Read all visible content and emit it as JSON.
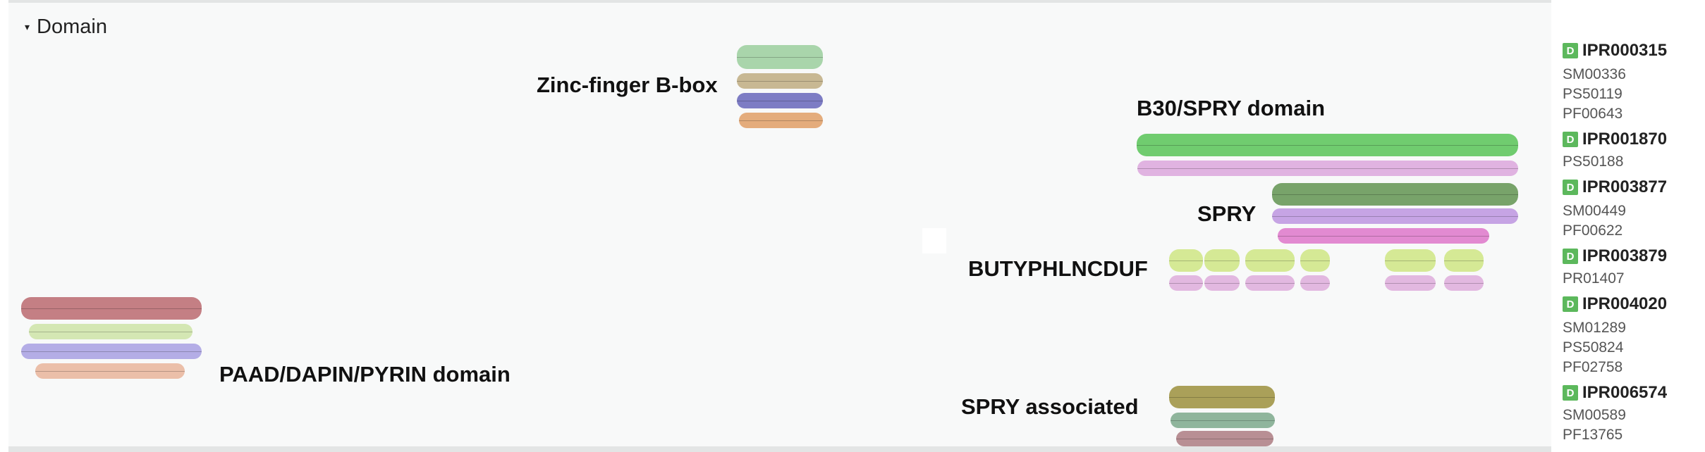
{
  "section": {
    "title": "Domain",
    "toggle_glyph": "▾"
  },
  "domains": [
    {
      "label": "Zinc-finger B-box",
      "track_colors": [
        "#a9d5ab",
        "#c8b893",
        "#7d7cc4",
        "#e4ac7c"
      ]
    },
    {
      "label": "B30/SPRY domain",
      "track_colors": [
        "#70cc6f",
        "#e0b3e1"
      ]
    },
    {
      "label": "SPRY",
      "track_colors": [
        "#78a36a",
        "#c6a4e4",
        "#e28ad1"
      ]
    },
    {
      "label": "BUTYPHLNCDUF",
      "track_colors": [
        "#d5e995",
        "#e2b8e0"
      ]
    },
    {
      "label": "PAAD/DAPIN/PYRIN domain",
      "track_colors": [
        "#c47f84",
        "#d4e7b3",
        "#b4ade6",
        "#ebbfa9"
      ]
    },
    {
      "label": "SPRY associated",
      "track_colors": [
        "#aaa059",
        "#8fb59c",
        "#b88f94"
      ]
    }
  ],
  "entries": [
    {
      "badge": "D",
      "id": "IPR000315",
      "members": [
        "SM00336",
        "PS50119",
        "PF00643"
      ]
    },
    {
      "badge": "D",
      "id": "IPR001870",
      "members": [
        "PS50188"
      ]
    },
    {
      "badge": "D",
      "id": "IPR003877",
      "members": [
        "SM00449",
        "PF00622"
      ]
    },
    {
      "badge": "D",
      "id": "IPR003879",
      "members": [
        "PR01407"
      ]
    },
    {
      "badge": "D",
      "id": "IPR004020",
      "members": [
        "SM01289",
        "PS50824",
        "PF02758"
      ]
    },
    {
      "badge": "D",
      "id": "IPR006574",
      "members": [
        "SM00589",
        "PF13765"
      ]
    }
  ],
  "colors": {
    "badge": "#5cb85c",
    "panel_background": "#f8f9f9"
  }
}
